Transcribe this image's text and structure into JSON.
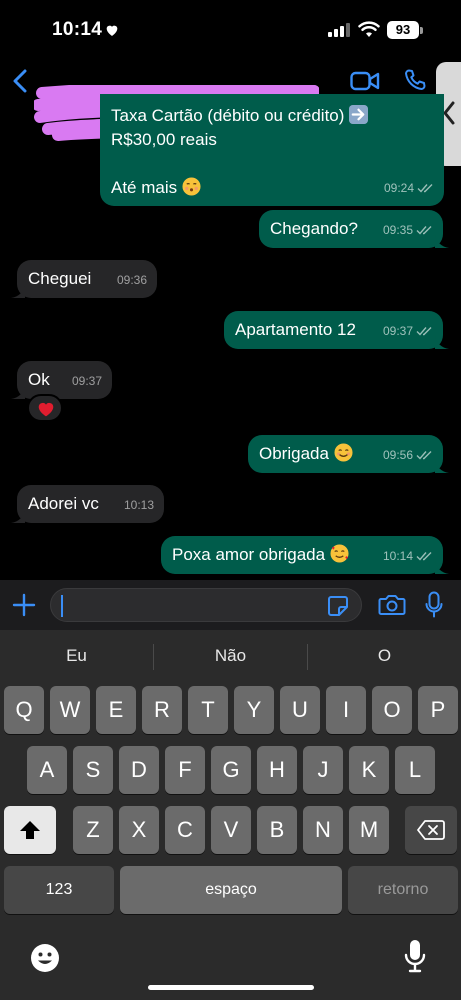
{
  "status_bar": {
    "time": "10:14",
    "battery": "93"
  },
  "header": {
    "contact_name": "",
    "icons": [
      "back-chevron-icon",
      "video-call-icon",
      "phone-icon",
      "side-handle-chevron-icon"
    ]
  },
  "colors": {
    "outgoing_bubble": "#005c4b",
    "incoming_bubble": "#262628",
    "accent": "#3a8ef6",
    "background": "#000000"
  },
  "messages": [
    {
      "dir": "out",
      "line1": "Taxa Cartão (débito ou crédito)",
      "line2": "R$30,00 reais",
      "line3": "Até mais",
      "time": "09:24"
    },
    {
      "dir": "out",
      "text": "Chegando?",
      "time": "09:35"
    },
    {
      "dir": "in",
      "text": "Cheguei",
      "time": "09:36"
    },
    {
      "dir": "out",
      "text": "Apartamento 12",
      "time": "09:37"
    },
    {
      "dir": "in",
      "text": "Ok",
      "time": "09:37",
      "reaction": "heart"
    },
    {
      "dir": "out",
      "text": "Obrigada",
      "time": "09:56"
    },
    {
      "dir": "in",
      "text": "Adorei vc",
      "time": "10:13"
    },
    {
      "dir": "out",
      "text": "Poxa amor obrigada",
      "time": "10:14"
    }
  ],
  "input": {
    "value": "",
    "placeholder": ""
  },
  "keyboard": {
    "suggestions": [
      "Eu",
      "Não",
      "O"
    ],
    "row1": [
      "Q",
      "W",
      "E",
      "R",
      "T",
      "Y",
      "U",
      "I",
      "O",
      "P"
    ],
    "row2": [
      "A",
      "S",
      "D",
      "F",
      "G",
      "H",
      "J",
      "K",
      "L"
    ],
    "row3": [
      "Z",
      "X",
      "C",
      "V",
      "B",
      "N",
      "M"
    ],
    "numbers_label": "123",
    "space_label": "espaço",
    "return_label": "retorno"
  }
}
